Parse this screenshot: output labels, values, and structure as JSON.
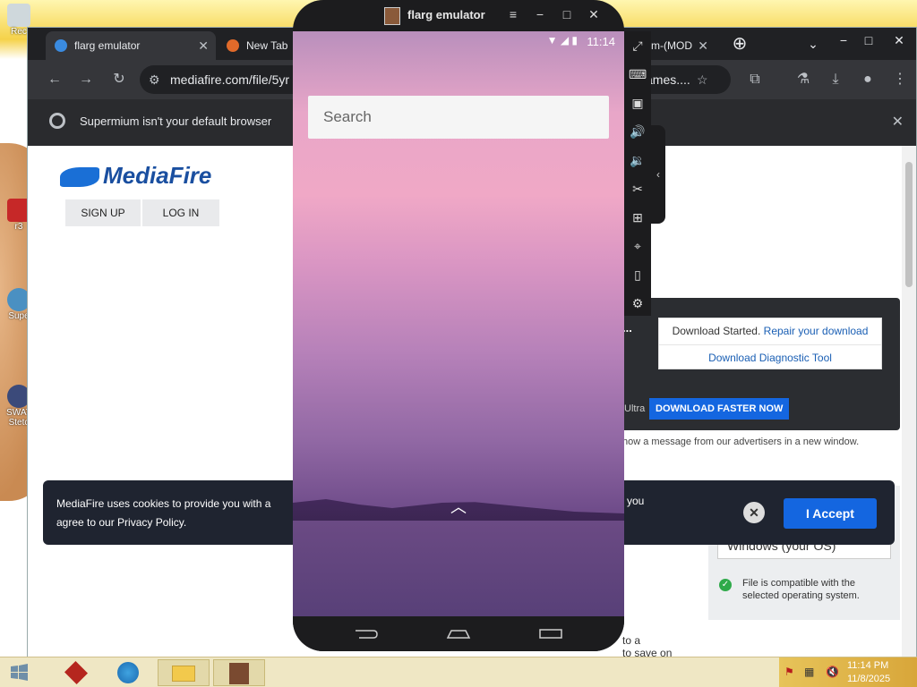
{
  "desktop": {
    "icons": [
      "Rec",
      "r3",
      "Supe",
      "SWAT Stetc"
    ]
  },
  "browser": {
    "tabs": [
      {
        "label": "flarg emulator",
        "active": true
      },
      {
        "label": "New Tab",
        "active": false
      },
      {
        "label": "m-(MOD",
        "active": false
      }
    ],
    "url": "mediafire.com/file/5yr",
    "url_tail": "ames....",
    "infobar_text": "Supermium isn't your default browser"
  },
  "mediafire": {
    "logo": "MediaFire",
    "signup": "SIGN UP",
    "login": "LOG IN",
    "download_started": "Download Started.",
    "repair_link": "Repair your download",
    "diagnostic_link": "Download Diagnostic Tool",
    "ultra": "Ultra",
    "download_faster": "DOWNLOAD FASTER NOW",
    "ellipsis": "...",
    "advertisers_note": "how a message from our advertisers in a new window.",
    "os_select": "Windows (your OS)",
    "compat_text": "File is compatible with the selected operating system.",
    "bottom_text_1": "to a",
    "bottom_text_2": "to save on"
  },
  "cookie": {
    "message": "MediaFire uses cookies to provide you with a",
    "message2": "agree to our Privacy Policy.",
    "you": "you",
    "accept": "I Accept",
    "close": "✕"
  },
  "emulator": {
    "title": "flarg emulator",
    "time": "11:14",
    "search_placeholder": "Search"
  },
  "taskbar": {
    "time": "11:14 PM",
    "date": "11/8/2025"
  }
}
